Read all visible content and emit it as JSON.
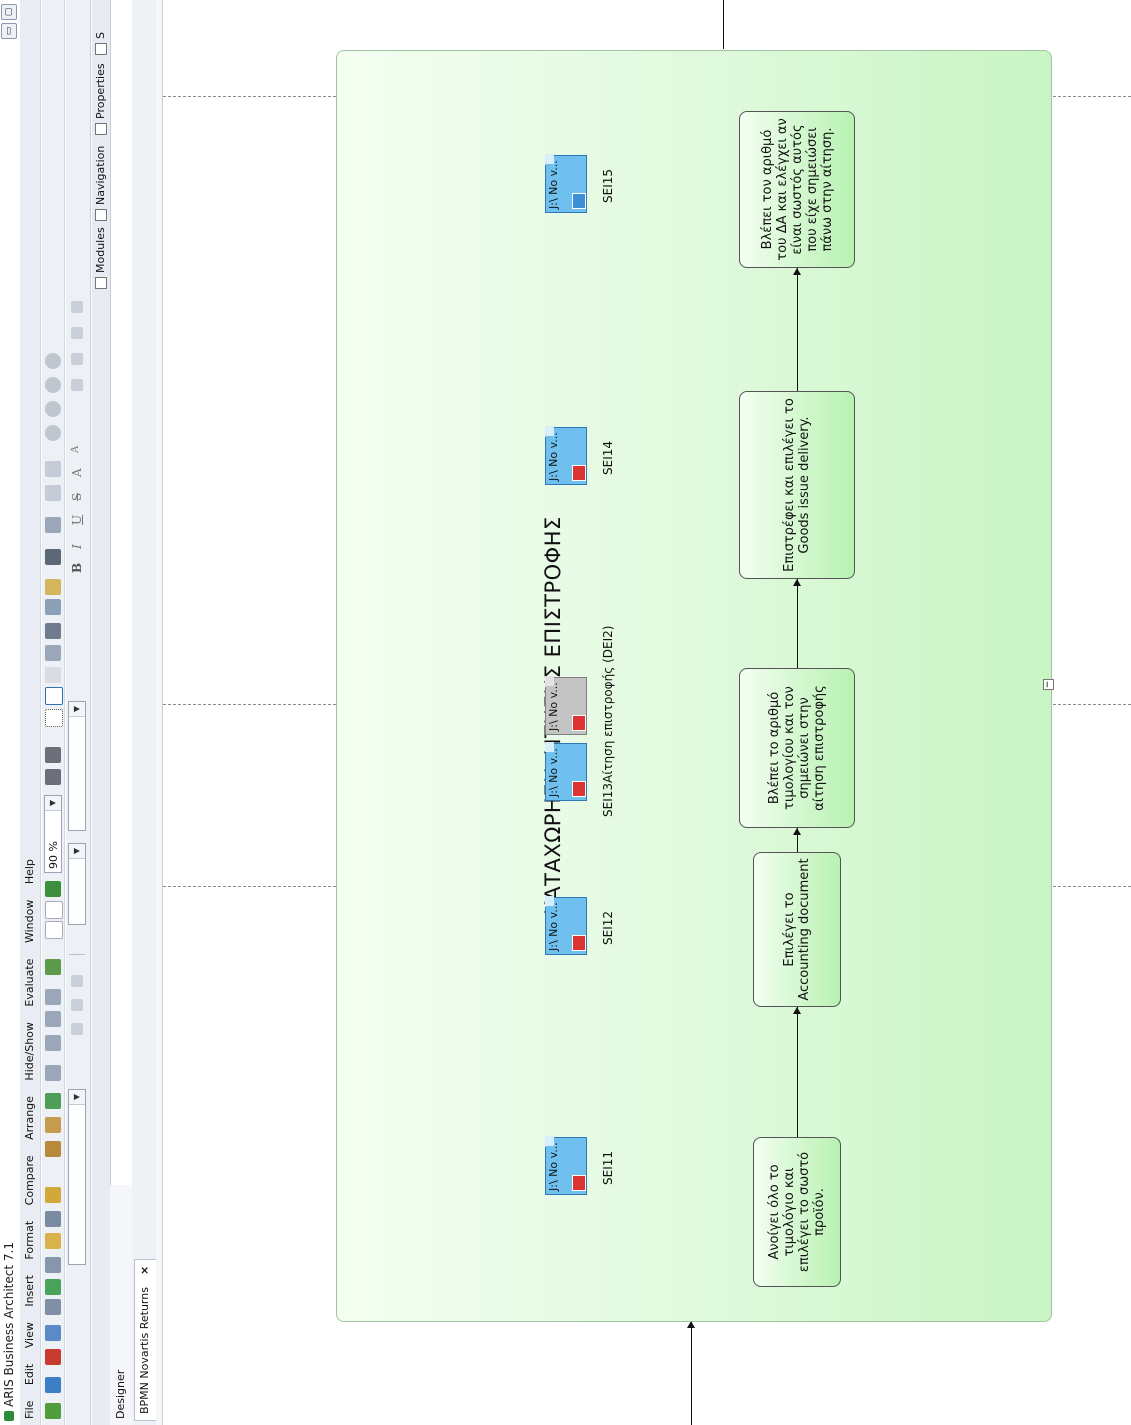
{
  "window": {
    "title": "ARIS Business Architect 7.1"
  },
  "menu": [
    "File",
    "Edit",
    "View",
    "Insert",
    "Format",
    "Compare",
    "Arrange",
    "Hide/Show",
    "Evaluate",
    "Window",
    "Help"
  ],
  "toolbar": {
    "zoom": "90 %"
  },
  "modules": [
    {
      "label": "Modules",
      "checked": false
    },
    {
      "label": "Navigation",
      "checked": false
    },
    {
      "label": "Properties",
      "checked": false
    },
    {
      "label": "S",
      "checked": false
    }
  ],
  "designer_label": "Designer",
  "tab": {
    "label": "BPMN Novartis Returns",
    "close": "×"
  },
  "lane": {
    "title": "ΚΑΤΑΧΩΡΗΣΗ ΑΙΤΗΣΗΣ ΕΠΙΣΤΡΟΦΗΣ",
    "collapse": "−"
  },
  "tasks": [
    "Ανοίγει όλο το τιμολόγιο και επιλέγει το σωστό προϊόν.",
    "Επιλέγει το Accounting document",
    "Βλέπει το αριθμό τιμολογίου και τον σημειώνει στην αίτηση επιστροφής",
    "Επιστρέφει και επιλέγει το Goods issue delivery.",
    "Βλέπει τον αριθμό του ΔΑ και ελέγχει αν είναι σωστός αυτός που είχε σημειώσει πάνω στην αίτηση."
  ],
  "documents": [
    {
      "label": "SEI11",
      "text": "J:\\ No v...",
      "style": "blue"
    },
    {
      "label": "SEI12",
      "text": "J:\\ No v...",
      "style": "blue"
    },
    {
      "label": "SEI13",
      "text": "J:\\ No v...",
      "style": "blue"
    },
    {
      "label": "Αίτηση επιστροφής (DEI2)",
      "text": "J:\\ No v...",
      "style": "gray"
    },
    {
      "label": "SEI14",
      "text": "J:\\ No v...",
      "style": "blue"
    },
    {
      "label": "SEI15",
      "text": "J:\\ No v...",
      "style": "blue-image"
    }
  ]
}
